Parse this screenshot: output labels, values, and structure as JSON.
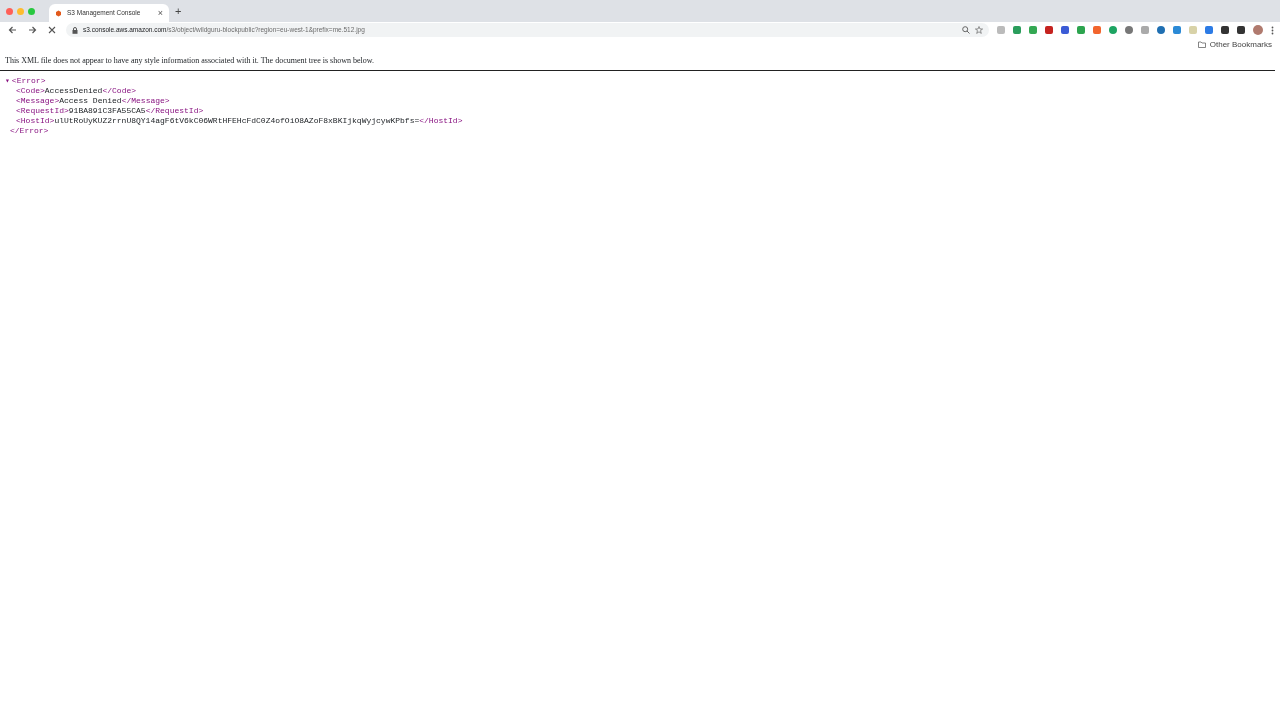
{
  "tab": {
    "title": "S3 Management Console",
    "close": "×",
    "new_tab": "+"
  },
  "toolbar": {
    "loading": true,
    "url_host": "s3.console.aws.amazon.com",
    "url_path": "/s3/object/wildguru-blockpublic?region=eu-west-1&prefix=me.512.jpg"
  },
  "bookmarks": {
    "other": "Other Bookmarks"
  },
  "page": {
    "notice": "This XML file does not appear to have any style information associated with it. The document tree is shown below.",
    "tree": {
      "toggle": "▾",
      "expanded": true,
      "open": "<Error>",
      "close": "</Error>",
      "children": [
        {
          "open": "<Code>",
          "value": "AccessDenied",
          "close": "</Code>"
        },
        {
          "open": "<Message>",
          "value": "Access Denied",
          "close": "</Message>"
        },
        {
          "open": "<RequestId>",
          "value": "91BA891C3FA55CA5",
          "close": "</RequestId>"
        },
        {
          "open": "<HostId>",
          "value": "ulUtRoUyKUZ2rrnU8QY14agF6tV6kC06WRtHFEHcFdC0Z4ofOiO8AZoF8xBKIjkqWyjcywKPbfs=",
          "close": "</HostId>"
        }
      ]
    }
  }
}
